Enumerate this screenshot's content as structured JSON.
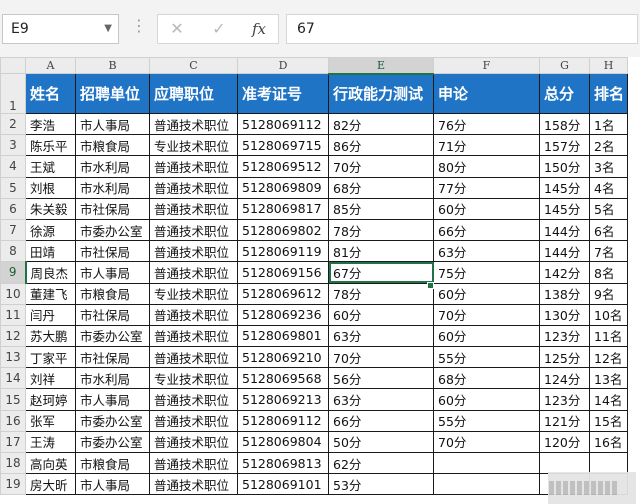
{
  "name_box": "E9",
  "formula_value": "67",
  "toolbar": {
    "cancel_icon": "✕",
    "enter_icon": "✓",
    "fx_label": "fx"
  },
  "columns": [
    "A",
    "B",
    "C",
    "D",
    "E",
    "F",
    "G",
    "H"
  ],
  "selected_column": "E",
  "selected_row": 9,
  "headers": [
    "姓名",
    "招聘单位",
    "应聘职位",
    "准考证号",
    "行政能力测试",
    "申论",
    "总分",
    "排名"
  ],
  "rows": [
    {
      "n": "2",
      "cells": [
        "李浩",
        "市人事局",
        "普通技术职位",
        "5128069112",
        "82分",
        "76分",
        "158分",
        "1名"
      ]
    },
    {
      "n": "3",
      "cells": [
        "陈乐平",
        "市粮食局",
        "专业技术职位",
        "5128069715",
        "86分",
        "71分",
        "157分",
        "2名"
      ]
    },
    {
      "n": "4",
      "cells": [
        "王斌",
        "市水利局",
        "普通技术职位",
        "5128069512",
        "70分",
        "80分",
        "150分",
        "3名"
      ]
    },
    {
      "n": "5",
      "cells": [
        "刘根",
        "市水利局",
        "普通技术职位",
        "5128069809",
        "68分",
        "77分",
        "145分",
        "4名"
      ]
    },
    {
      "n": "6",
      "cells": [
        "朱关毅",
        "市社保局",
        "普通技术职位",
        "5128069817",
        "85分",
        "60分",
        "145分",
        "5名"
      ]
    },
    {
      "n": "7",
      "cells": [
        "徐源",
        "市委办公室",
        "普通技术职位",
        "5128069802",
        "78分",
        "66分",
        "144分",
        "6名"
      ]
    },
    {
      "n": "8",
      "cells": [
        "田靖",
        "市社保局",
        "普通技术职位",
        "5128069119",
        "81分",
        "63分",
        "144分",
        "7名"
      ]
    },
    {
      "n": "9",
      "cells": [
        "周良杰",
        "市人事局",
        "普通技术职位",
        "5128069156",
        "67分",
        "75分",
        "142分",
        "8名"
      ]
    },
    {
      "n": "10",
      "cells": [
        "董建飞",
        "市粮食局",
        "专业技术职位",
        "5128069612",
        "78分",
        "60分",
        "138分",
        "9名"
      ]
    },
    {
      "n": "11",
      "cells": [
        "闫丹",
        "市社保局",
        "普通技术职位",
        "5128069236",
        "60分",
        "70分",
        "130分",
        "10名"
      ]
    },
    {
      "n": "12",
      "cells": [
        "苏大鹏",
        "市委办公室",
        "普通技术职位",
        "5128069801",
        "63分",
        "60分",
        "123分",
        "11名"
      ]
    },
    {
      "n": "13",
      "cells": [
        "丁家平",
        "市社保局",
        "普通技术职位",
        "5128069210",
        "70分",
        "55分",
        "125分",
        "12名"
      ]
    },
    {
      "n": "14",
      "cells": [
        "刘祥",
        "市水利局",
        "专业技术职位",
        "5128069568",
        "56分",
        "68分",
        "124分",
        "13名"
      ]
    },
    {
      "n": "15",
      "cells": [
        "赵珂婷",
        "市人事局",
        "普通技术职位",
        "5128069213",
        "63分",
        "60分",
        "123分",
        "14名"
      ]
    },
    {
      "n": "16",
      "cells": [
        "张军",
        "市委办公室",
        "普通技术职位",
        "5128069112",
        "66分",
        "55分",
        "121分",
        "15名"
      ]
    },
    {
      "n": "17",
      "cells": [
        "王涛",
        "市委办公室",
        "普通技术职位",
        "5128069804",
        "50分",
        "70分",
        "120分",
        "16名"
      ]
    },
    {
      "n": "18",
      "cells": [
        "高向英",
        "市粮食局",
        "普通技术职位",
        "5128069813",
        "62分",
        "",
        "",
        ""
      ]
    },
    {
      "n": "19",
      "cells": [
        "房大昕",
        "市人事局",
        "普通技术职位",
        "5128069101",
        "53分",
        "",
        "",
        ""
      ]
    }
  ]
}
